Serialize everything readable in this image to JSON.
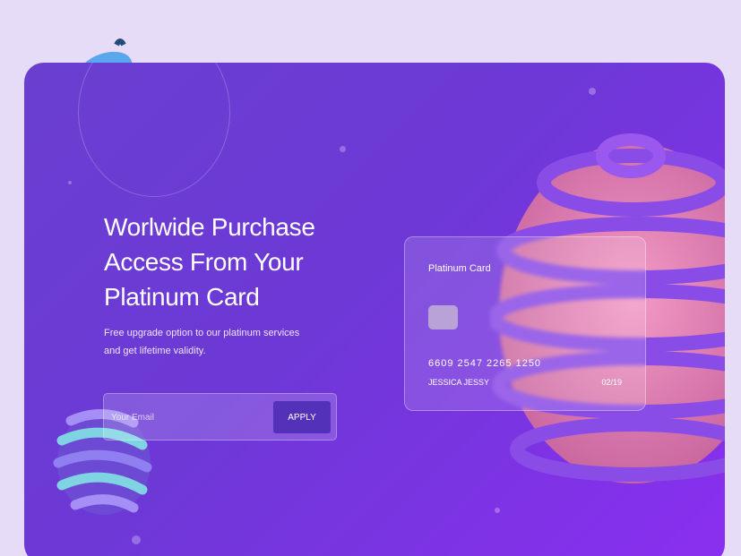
{
  "hero": {
    "title_lines": [
      "Worlwide Purchase",
      "Access From Your",
      "Platinum Card"
    ],
    "subtitle": "Free upgrade option to our platinum services and get lifetime validity."
  },
  "form": {
    "email_placeholder": "Your Email",
    "apply_label": "APPLY"
  },
  "card": {
    "title": "Platinum Card",
    "number": "6609 2547 2265 1250",
    "holder": "JESSICA JESSY",
    "expiry": "02/19"
  },
  "colors": {
    "background": "#e7dcf7",
    "panel_start": "#6a3fd0",
    "panel_end": "#8a2ff0",
    "button": "#5331b8"
  }
}
